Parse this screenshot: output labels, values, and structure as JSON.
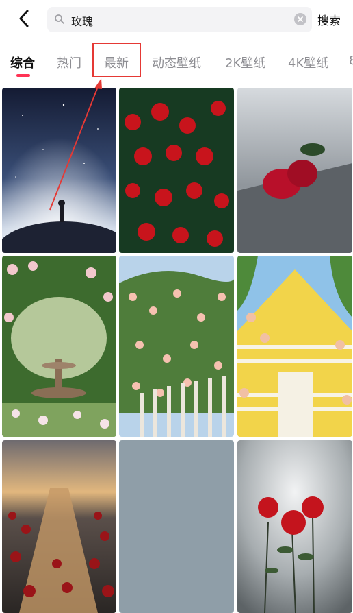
{
  "search": {
    "query": "玫瑰",
    "button_label": "搜索"
  },
  "tabs": [
    {
      "label": "综合",
      "active": true
    },
    {
      "label": "热门",
      "active": false
    },
    {
      "label": "最新",
      "active": false,
      "highlighted": true
    },
    {
      "label": "动态壁纸",
      "active": false
    },
    {
      "label": "2K壁纸",
      "active": false
    },
    {
      "label": "4K壁纸",
      "active": false
    }
  ],
  "colors": {
    "accent": "#ff3355",
    "highlight": "#e53935"
  },
  "grid": {
    "wallpapers": [
      {
        "subject": "little prince on planet under starry sky"
      },
      {
        "subject": "red roses bush"
      },
      {
        "subject": "red rose on snowy ledge"
      },
      {
        "subject": "rose garden with fountain"
      },
      {
        "subject": "pink climbing roses over fence"
      },
      {
        "subject": "yellow house with roses"
      },
      {
        "subject": "river of roses at sunset"
      },
      {
        "subject": "gray placeholder"
      },
      {
        "subject": "red roses in fog"
      }
    ]
  }
}
